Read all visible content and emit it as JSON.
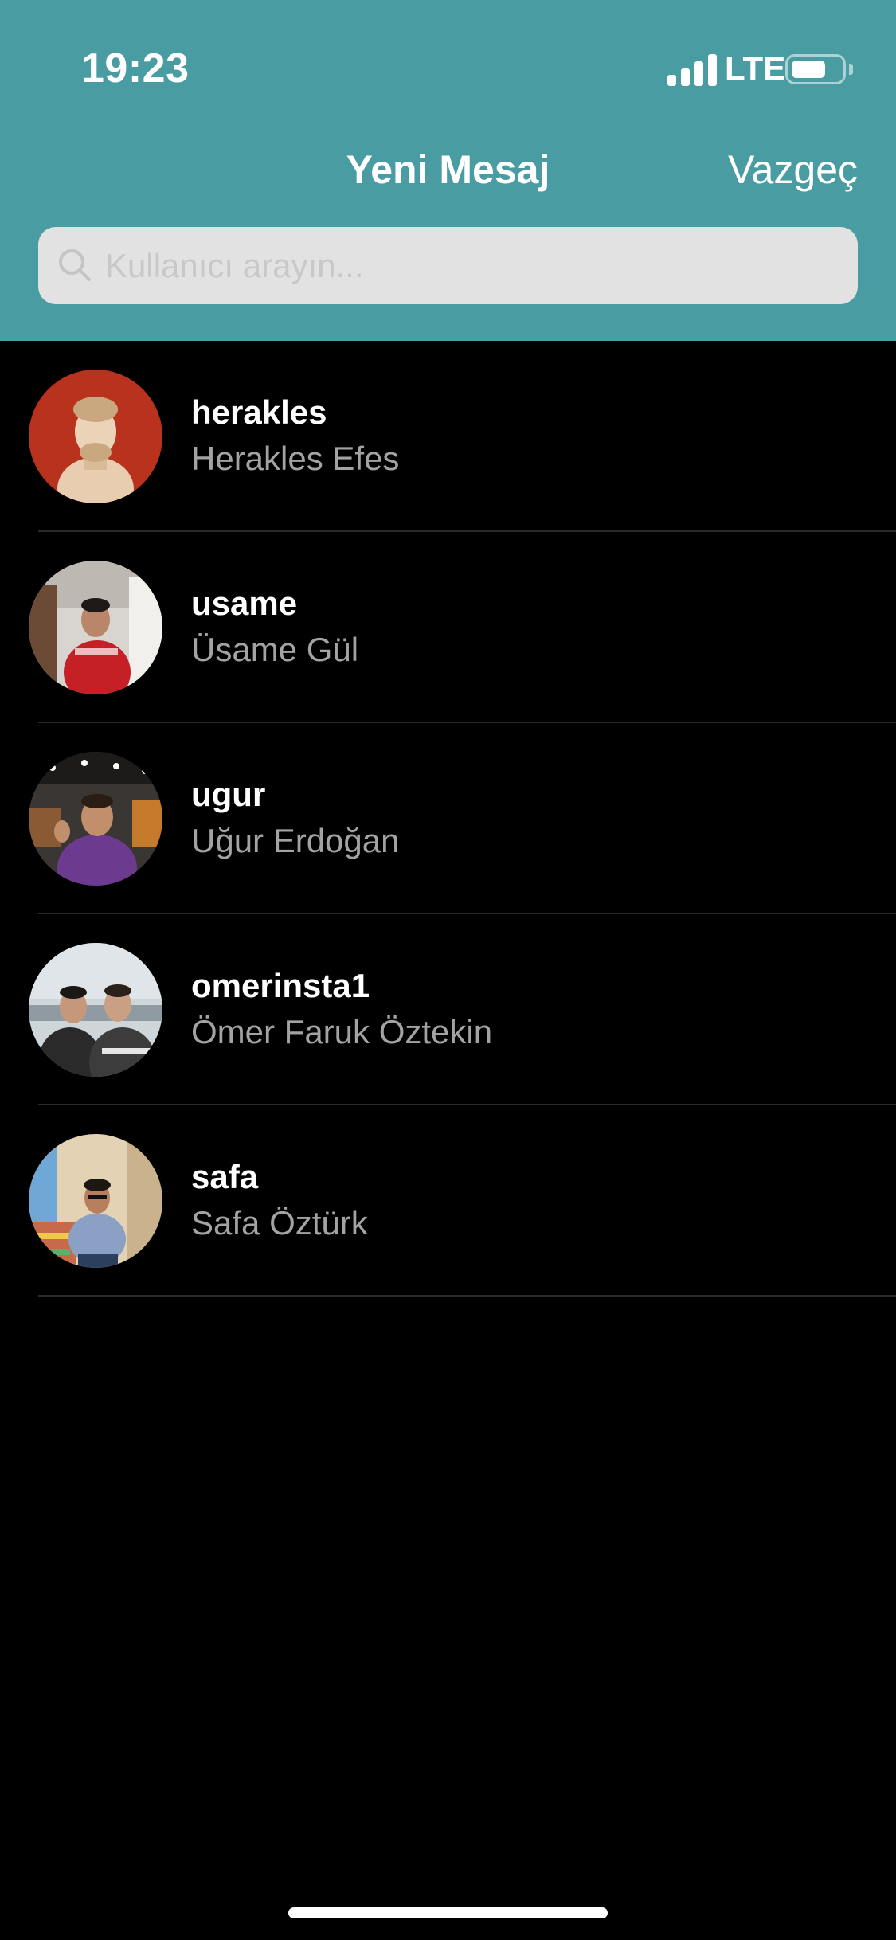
{
  "status_bar": {
    "time": "19:23",
    "network": "LTE",
    "icons": [
      "signal-bars-icon",
      "battery-icon"
    ]
  },
  "nav": {
    "title": "Yeni Mesaj",
    "cancel_label": "Vazgeç"
  },
  "search": {
    "placeholder": "Kullanıcı arayın...",
    "value": "",
    "icon": "search-icon"
  },
  "users": [
    {
      "username": "herakles",
      "full_name": "Herakles Efes"
    },
    {
      "username": "usame",
      "full_name": "Üsame Gül"
    },
    {
      "username": "ugur",
      "full_name": "Uğur Erdoğan"
    },
    {
      "username": "omerinsta1",
      "full_name": "Ömer Faruk Öztekin"
    },
    {
      "username": "safa",
      "full_name": "Safa Öztürk"
    }
  ],
  "colors": {
    "header_bg": "#4a9ca3",
    "background": "#000000",
    "secondary_text": "#a3a3a3",
    "search_bg": "#e2e2e2"
  }
}
